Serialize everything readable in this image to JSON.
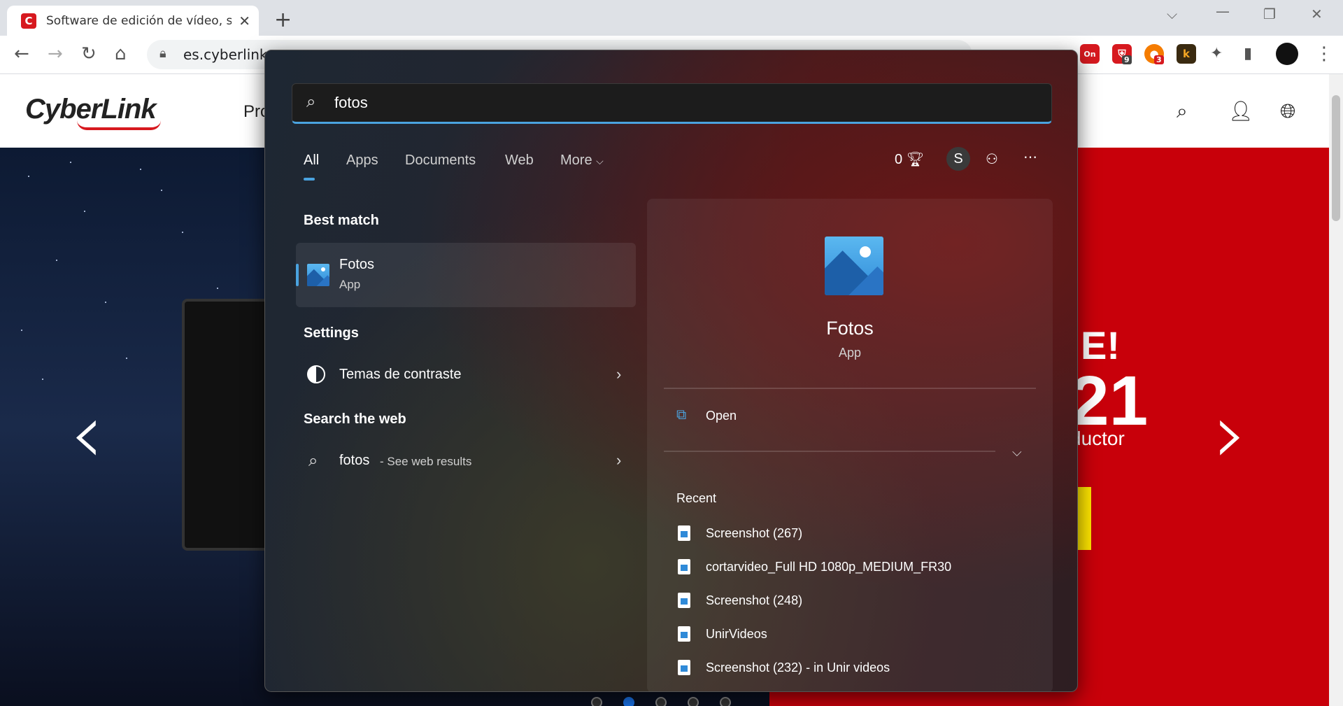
{
  "browser": {
    "tab_title": "Software de edición de vídeo, so",
    "tab_favicon_letter": "C",
    "url": "es.cyberlink.c",
    "extensions": [
      {
        "name": "avast-extension",
        "color": "#d7191f",
        "badge": "9"
      },
      {
        "name": "basket-extension",
        "color": "#f57c00",
        "badge": "3"
      },
      {
        "name": "k-extension",
        "color": "#3a2a10",
        "letter": "k"
      }
    ],
    "on_badge": "On"
  },
  "site": {
    "logo": "CyberLink",
    "nav_partial": "Pro",
    "promo_exclaim": "E!",
    "promo_number": "21",
    "promo_text": "ductor"
  },
  "search": {
    "query": "fotos",
    "tabs": [
      "All",
      "Apps",
      "Documents",
      "Web",
      "More"
    ],
    "rewards_count": "0",
    "avatar_letter": "S",
    "best_match_heading": "Best match",
    "best_match": {
      "name": "Fotos",
      "type": "App"
    },
    "settings_heading": "Settings",
    "settings_item": "Temas de contraste",
    "web_heading": "Search the web",
    "web_query": "fotos",
    "web_suffix": "- See web results",
    "detail": {
      "name": "Fotos",
      "type": "App",
      "open_label": "Open",
      "recent_heading": "Recent",
      "recent": [
        "Screenshot (267)",
        "cortarvideo_Full HD 1080p_MEDIUM_FR30",
        "Screenshot (248)",
        "UnirVideos",
        "Screenshot (232) - in Unir videos"
      ]
    }
  },
  "carousel": {
    "dot_count": 5,
    "active_index": 1
  }
}
